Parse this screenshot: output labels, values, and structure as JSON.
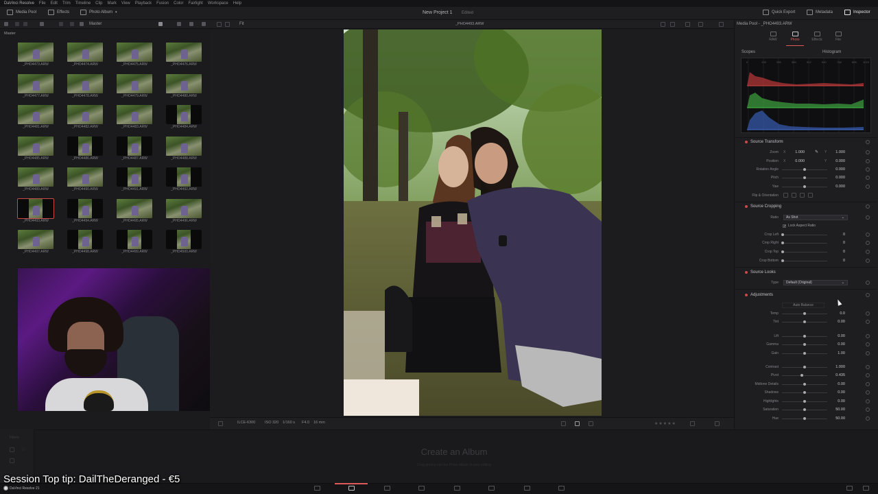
{
  "menubar": [
    "DaVinci Resolve",
    "File",
    "Edit",
    "Trim",
    "Timeline",
    "Clip",
    "Mark",
    "View",
    "Playback",
    "Fusion",
    "Color",
    "Fairlight",
    "Workspace",
    "Help"
  ],
  "topbar": {
    "media_pool": "Media Pool",
    "effects": "Effects",
    "photo_album": "Photo Album",
    "project": "New Project 1",
    "edited": "Edited",
    "quick_export": "Quick Export",
    "metadata": "Metadata",
    "inspector": "Inspector"
  },
  "media_pool": {
    "master": "Master",
    "bin": "Master",
    "clips": [
      {
        "name": "_PHO4473.ARW",
        "portrait": false
      },
      {
        "name": "_PHO4474.ARW",
        "portrait": false
      },
      {
        "name": "_PHO4475.ARW",
        "portrait": false
      },
      {
        "name": "_PHO4476.ARW",
        "portrait": false
      },
      {
        "name": "_PHO4477.ARW",
        "portrait": false
      },
      {
        "name": "_PHO4478.ARW",
        "portrait": false
      },
      {
        "name": "_PHO4479.ARW",
        "portrait": false
      },
      {
        "name": "_PHO4480.ARW",
        "portrait": false
      },
      {
        "name": "_PHO4481.ARW",
        "portrait": false
      },
      {
        "name": "_PHO4482.ARW",
        "portrait": false
      },
      {
        "name": "_PHO4483.ARW",
        "portrait": false
      },
      {
        "name": "_PHO4484.ARW",
        "portrait": true
      },
      {
        "name": "_PHO4485.ARW",
        "portrait": false
      },
      {
        "name": "_PHO4486.ARW",
        "portrait": true
      },
      {
        "name": "_PHO4487.ARW",
        "portrait": true
      },
      {
        "name": "_PHO4488.ARW",
        "portrait": false
      },
      {
        "name": "_PHO4489.ARW",
        "portrait": false
      },
      {
        "name": "_PHO4490.ARW",
        "portrait": false
      },
      {
        "name": "_PHO4491.ARW",
        "portrait": true
      },
      {
        "name": "_PHO4492.ARW",
        "portrait": true
      },
      {
        "name": "_PHO4493.ARW",
        "portrait": true,
        "selected": true
      },
      {
        "name": "_PHO4494.ARW",
        "portrait": true
      },
      {
        "name": "_PHO4495.ARW",
        "portrait": false
      },
      {
        "name": "_PHO4496.ARW",
        "portrait": false
      },
      {
        "name": "_PHO4497.ARW",
        "portrait": false
      },
      {
        "name": "_PHO4498.ARW",
        "portrait": true
      },
      {
        "name": "_PHO4499.ARW",
        "portrait": true
      },
      {
        "name": "_PHO4500.ARW",
        "portrait": true
      }
    ]
  },
  "viewer": {
    "fit": "Fit",
    "title": "_PHO4493.ARW",
    "camera": "ILCE-6300",
    "iso": "ISO 320",
    "shutter": "1/160 s",
    "aperture": "F4.0",
    "focal": "16 mm"
  },
  "inspector": {
    "title": "Media Pool - _PHO4493.ARW",
    "tabs": [
      "RAW",
      "Photo",
      "Effects",
      "File"
    ],
    "scopes": "Scopes",
    "histogram": "Histogram",
    "hist_ticks": [
      "0",
      "128",
      "256",
      "384",
      "512",
      "640",
      "768",
      "896",
      "1023"
    ],
    "source_transform": {
      "title": "Source Transform",
      "zoom_label": "Zoom",
      "zoom_x": "1.000",
      "zoom_y": "1.000",
      "position_label": "Position",
      "pos_x": "0.000",
      "pos_y": "0.000",
      "rotation_label": "Rotation Angle",
      "rotation": "0.000",
      "pitch_label": "Pitch",
      "pitch": "0.000",
      "yaw_label": "Yaw",
      "yaw": "0.000",
      "flip_label": "Flip & Orientation",
      "x": "X",
      "y": "Y"
    },
    "source_cropping": {
      "title": "Source Cropping",
      "ratio_label": "Ratio",
      "ratio": "As Shot",
      "lock_aspect": "Lock Aspect Ratio",
      "crop_left_label": "Crop Left",
      "crop_left": "0",
      "crop_right_label": "Crop Right",
      "crop_right": "0",
      "crop_top_label": "Crop Top",
      "crop_top": "0",
      "crop_bottom_label": "Crop Bottom",
      "crop_bottom": "0"
    },
    "source_looks": {
      "title": "Source Looks",
      "type_label": "Type",
      "type": "Default (Original)"
    },
    "adjustments": {
      "title": "Adjustments",
      "auto_balance": "Auto Balance",
      "rows": [
        {
          "label": "Temp",
          "value": "0.0"
        },
        {
          "label": "Tint",
          "value": "0.00"
        },
        {
          "label": "Lift",
          "value": "0.00"
        },
        {
          "label": "Gamma",
          "value": "0.00"
        },
        {
          "label": "Gain",
          "value": "1.00"
        },
        {
          "label": "Contrast",
          "value": "1.000"
        },
        {
          "label": "Pivot",
          "value": "0.435"
        },
        {
          "label": "Midtone Details",
          "value": "0.00"
        },
        {
          "label": "Shadows",
          "value": "0.00"
        },
        {
          "label": "Highlights",
          "value": "0.00"
        },
        {
          "label": "Saturation",
          "value": "50.00"
        },
        {
          "label": "Hue",
          "value": "50.00"
        }
      ]
    }
  },
  "album": {
    "title": "Create an Album",
    "subtitle": "Drag photos into the Photo Album to start editing",
    "filters": "Filters"
  },
  "bottom": {
    "brand": "DaVinci Resolve 21"
  },
  "overlay": {
    "tip": "Session Top tip: DailTheDeranged - €5"
  },
  "colors": {
    "accent": "#e05a5a",
    "background": "#1b1b1e",
    "panel": "#1e1e21"
  }
}
